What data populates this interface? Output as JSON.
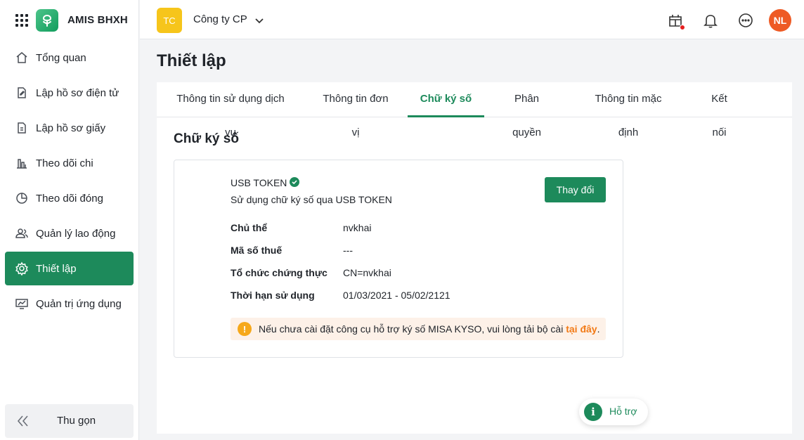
{
  "app": {
    "name": "AMIS BHXH"
  },
  "sidebar": {
    "items": [
      {
        "label": "Tổng quan",
        "icon": "home-icon"
      },
      {
        "label": "Lập hồ sơ điện tử",
        "icon": "edit-document-icon"
      },
      {
        "label": "Lập hồ sơ giấy",
        "icon": "paper-document-icon"
      },
      {
        "label": "Theo dõi chi",
        "icon": "bar-chart-icon"
      },
      {
        "label": "Theo dõi đóng",
        "icon": "pie-chart-icon"
      },
      {
        "label": "Quản lý lao động",
        "icon": "users-icon"
      },
      {
        "label": "Thiết lập",
        "icon": "gear-icon",
        "active": true
      },
      {
        "label": "Quản trị ứng dụng",
        "icon": "monitor-chart-icon"
      }
    ],
    "collapse_label": "Thu gọn"
  },
  "header": {
    "company_initials": "TC",
    "company_name": "Công ty CP",
    "avatar_initials": "NL"
  },
  "page": {
    "title": "Thiết lập"
  },
  "tabs": [
    {
      "label": "Thông tin sử dụng dịch vụ"
    },
    {
      "label": "Thông tin đơn vị"
    },
    {
      "label": "Chữ ký số",
      "active": true
    },
    {
      "label": "Phân quyền"
    },
    {
      "label": "Thông tin mặc định"
    },
    {
      "label": "Kết nối"
    }
  ],
  "signature": {
    "section_title": "Chữ ký số",
    "type": "USB TOKEN",
    "description": "Sử dụng chữ ký số qua USB TOKEN",
    "change_button": "Thay đổi",
    "rows": [
      {
        "label": "Chủ thể",
        "value": "nvkhai"
      },
      {
        "label": "Mã số thuế",
        "value": "---"
      },
      {
        "label": "Tổ chức chứng thực",
        "value": "CN=nvkhai"
      },
      {
        "label": "Thời hạn sử dụng",
        "value": "01/03/2021 - 05/02/2121"
      }
    ],
    "notice_text": "Nếu chưa cài đặt công cụ hỗ trợ ký số MISA KYSO, vui lòng tải bộ cài",
    "notice_link": "tại đây",
    "notice_end": "."
  },
  "support": {
    "label": "Hỗ trợ"
  },
  "colors": {
    "primary": "#1d8a5b",
    "badge": "#f6c51b",
    "avatar": "#ee5a24",
    "warning": "#f6a81a",
    "link": "#f27a16"
  }
}
